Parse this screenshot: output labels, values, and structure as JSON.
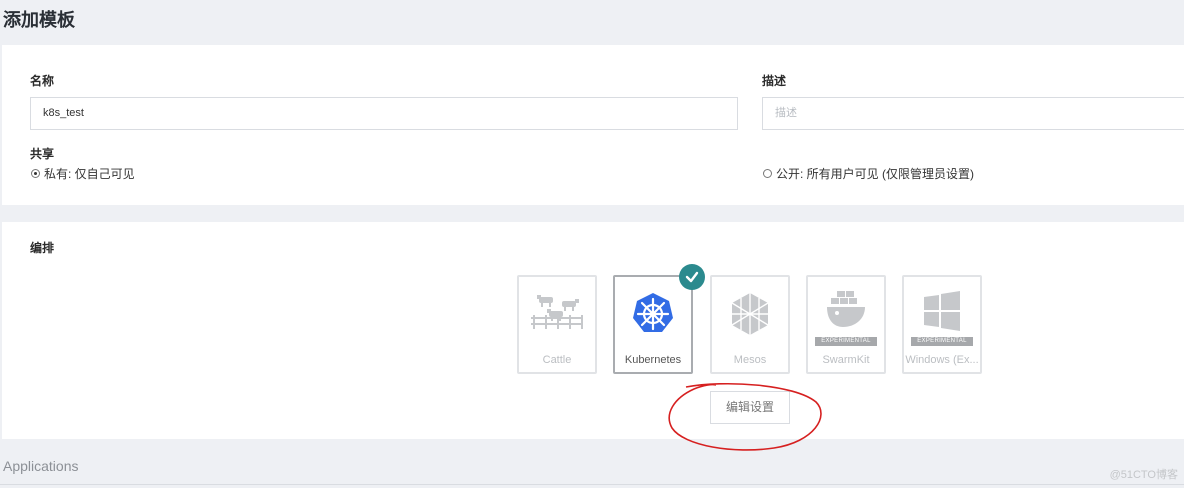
{
  "page": {
    "title": "添加模板"
  },
  "form": {
    "name_label": "名称",
    "name_value": "k8s_test",
    "desc_label": "描述",
    "desc_placeholder": "描述",
    "share_label": "共享",
    "private_option": "私有: 仅自己可见",
    "public_option": "公开: 所有用户可见 (仅限管理员设置)"
  },
  "orchestration": {
    "label": "编排",
    "options": [
      {
        "name": "Cattle",
        "icon": "cattle-icon",
        "selected": false
      },
      {
        "name": "Kubernetes",
        "icon": "kubernetes-icon",
        "selected": true
      },
      {
        "name": "Mesos",
        "icon": "mesos-icon",
        "selected": false
      },
      {
        "name": "SwarmKit",
        "icon": "swarmkit-icon",
        "selected": false,
        "badge": "EXPERIMENTAL"
      },
      {
        "name": "Windows (Ex...",
        "icon": "windows-icon",
        "selected": false,
        "badge": "EXPERIMENTAL"
      }
    ],
    "edit_button": "编辑设置"
  },
  "applications": {
    "title": "Applications"
  },
  "watermark": "@51CTO博客",
  "colors": {
    "accent": "#2b8a8e",
    "kubernetes": "#326ce5",
    "annotation": "#d62020"
  }
}
